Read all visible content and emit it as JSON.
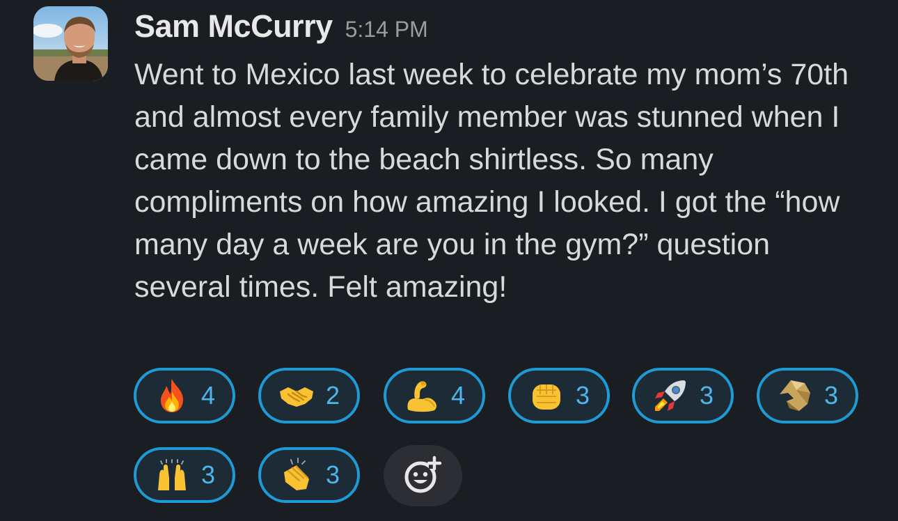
{
  "message": {
    "author": "Sam McCurry",
    "timestamp": "5:14 PM",
    "text": "Went to Mexico last week to celebrate my mom’s 70th and almost every family member was stunned when I came down to the beach shirtless. So many compliments on how amazing I looked. I got the “how many day a week are you in the gym?” question several times. Felt amazing!"
  },
  "reactions": [
    {
      "icon": "fire-emoji",
      "count": "4"
    },
    {
      "icon": "handshake-emoji",
      "count": "2"
    },
    {
      "icon": "flexed-biceps-emoji",
      "count": "4"
    },
    {
      "icon": "oncoming-fist-emoji",
      "count": "3"
    },
    {
      "icon": "rocket-emoji",
      "count": "3"
    },
    {
      "icon": "gold-lion-custom-emoji",
      "count": "3"
    },
    {
      "icon": "raising-hands-emoji",
      "count": "3"
    },
    {
      "icon": "clapping-hands-emoji",
      "count": "3"
    }
  ],
  "add_reaction": {
    "icon": "add-reaction-icon"
  },
  "colors": {
    "background": "#1a1d21",
    "reaction_border": "#1e9bd7",
    "reaction_count": "#4db6ec",
    "text": "#d8d9da"
  }
}
